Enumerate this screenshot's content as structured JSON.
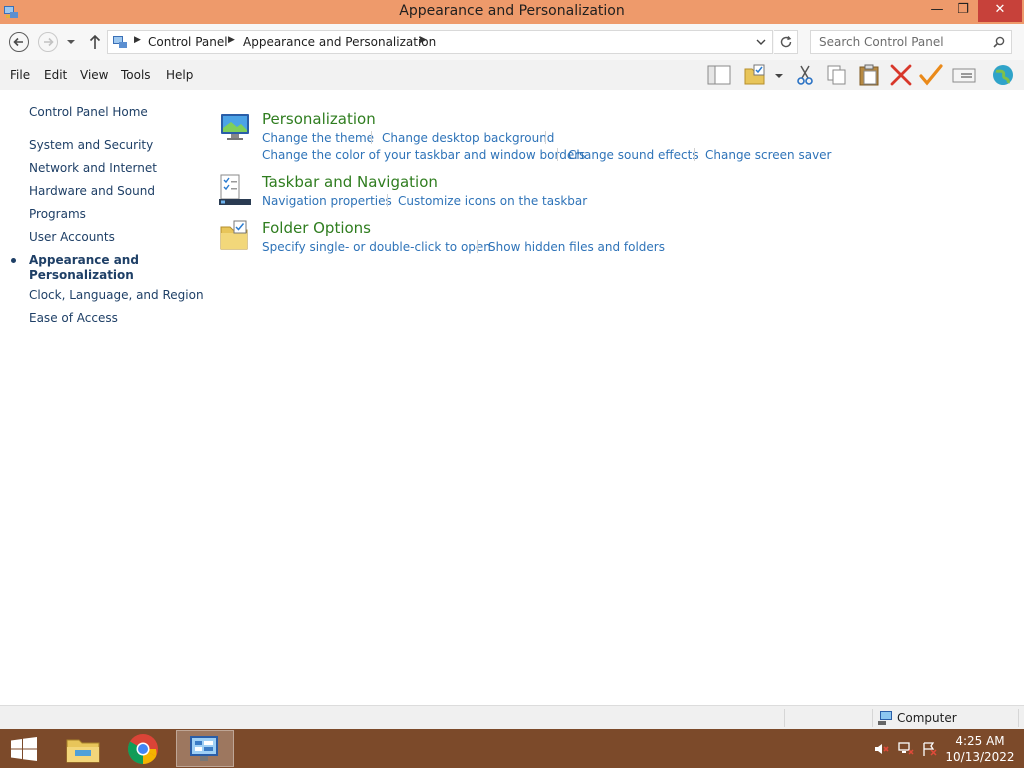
{
  "window": {
    "title": "Appearance and Personalization",
    "minimize": "—",
    "maximize": "❐",
    "close": "✕"
  },
  "address": {
    "breadcrumbs": [
      "Control Panel",
      "Appearance and Personalization"
    ],
    "search_placeholder": "Search Control Panel"
  },
  "menu": [
    "File",
    "Edit",
    "View",
    "Tools",
    "Help"
  ],
  "toolbar_icons": [
    "layout-icon",
    "folder-check-icon",
    "cut-icon",
    "copy-icon",
    "paste-icon",
    "delete-icon",
    "checkmark-icon",
    "properties-icon",
    "globe-icon"
  ],
  "sidebar": {
    "home": "Control Panel Home",
    "items": [
      "System and Security",
      "Network and Internet",
      "Hardware and Sound",
      "Programs",
      "User Accounts",
      "Appearance and Personalization",
      "Clock, Language, and Region",
      "Ease of Access"
    ],
    "active_index": 5
  },
  "categories": [
    {
      "title": "Personalization",
      "icon": "personalization-icon",
      "tasks": [
        "Change the theme",
        "Change desktop background",
        "Change the color of your taskbar and window borders",
        "Change sound effects",
        "Change screen saver"
      ]
    },
    {
      "title": "Taskbar and Navigation",
      "icon": "taskbar-icon",
      "tasks": [
        "Navigation properties",
        "Customize icons on the taskbar"
      ]
    },
    {
      "title": "Folder Options",
      "icon": "folder-options-icon",
      "tasks": [
        "Specify single- or double-click to open",
        "Show hidden files and folders"
      ]
    }
  ],
  "statusbar": {
    "location": "Computer"
  },
  "taskbar": {
    "time": "4:25 AM",
    "date": "10/13/2022",
    "apps": [
      "file-explorer-icon",
      "chrome-icon",
      "control-panel-icon"
    ]
  },
  "colors": {
    "titlebar": "#ee9a6b",
    "taskbar": "#7c4a2a",
    "category_title": "#2f7d1f",
    "task_link": "#2e73b8",
    "close_button": "#c7413a"
  }
}
